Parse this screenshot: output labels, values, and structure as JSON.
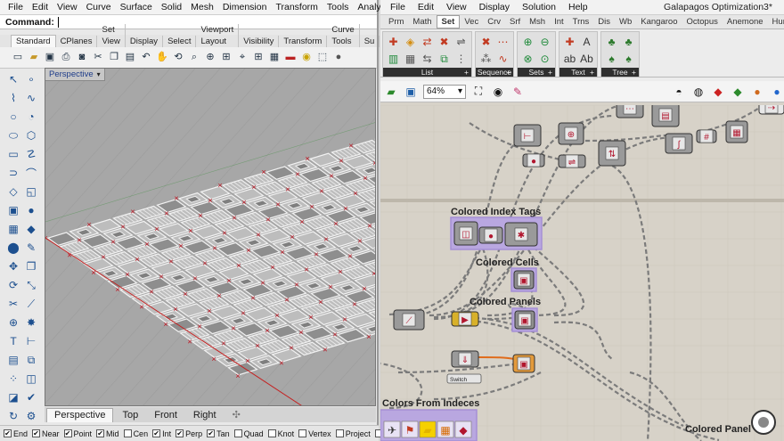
{
  "rhino": {
    "menus": [
      "File",
      "Edit",
      "View",
      "Curve",
      "Surface",
      "Solid",
      "Mesh",
      "Dimension",
      "Transform",
      "Tools",
      "Analyze",
      "Render",
      "Pane"
    ],
    "command_label": "Command:",
    "toolbar_tabs": [
      "Standard",
      "CPlanes",
      "Set View",
      "Display",
      "Select",
      "Viewport Layout",
      "Visibility",
      "Transform",
      "Curve Tools",
      "Su"
    ],
    "viewport_title": "Perspective",
    "viewport_tabs": [
      "Perspective",
      "Top",
      "Front",
      "Right"
    ],
    "add_tab_symbol": "✣",
    "osnaps": [
      {
        "label": "End",
        "checked": true
      },
      {
        "label": "Near",
        "checked": true
      },
      {
        "label": "Point",
        "checked": true
      },
      {
        "label": "Mid",
        "checked": true
      },
      {
        "label": "Cen",
        "checked": false
      },
      {
        "label": "Int",
        "checked": true
      },
      {
        "label": "Perp",
        "checked": true
      },
      {
        "label": "Tan",
        "checked": true
      },
      {
        "label": "Quad",
        "checked": false
      },
      {
        "label": "Knot",
        "checked": false
      },
      {
        "label": "Vertex",
        "checked": false
      },
      {
        "label": "Project",
        "checked": false
      },
      {
        "label": "Di",
        "checked": false
      }
    ]
  },
  "grasshopper": {
    "menus": [
      "File",
      "Edit",
      "View",
      "Display",
      "Solution",
      "Help"
    ],
    "window_title": "Galapagos Optimization3*",
    "tabs": [
      "Prm",
      "Math",
      "Set",
      "Vec",
      "Crv",
      "Srf",
      "Msh",
      "Int",
      "Trns",
      "Dis",
      "Wb",
      "Kangaroo",
      "Octopus",
      "Anemone",
      "Human",
      "S"
    ],
    "active_tab": "Set",
    "ribbon_groups": [
      "List",
      "Sequence",
      "Sets",
      "Text",
      "Tree"
    ],
    "zoom": "64%",
    "group_titles": {
      "colored_index_tags": "Colored Index Tags",
      "colored_cells": "Colored Cells",
      "colored_panels": "Colored Panels",
      "colors_from_indices": "Colors From Indeces",
      "colored_panels_2": "Colored Panel"
    },
    "slider_label": "Switch",
    "colors": {
      "group_fill": "#b9a7e0",
      "group_border": "#a58fd6",
      "canvas": "#d7d2c8",
      "wire": "#7b7b7b"
    }
  }
}
